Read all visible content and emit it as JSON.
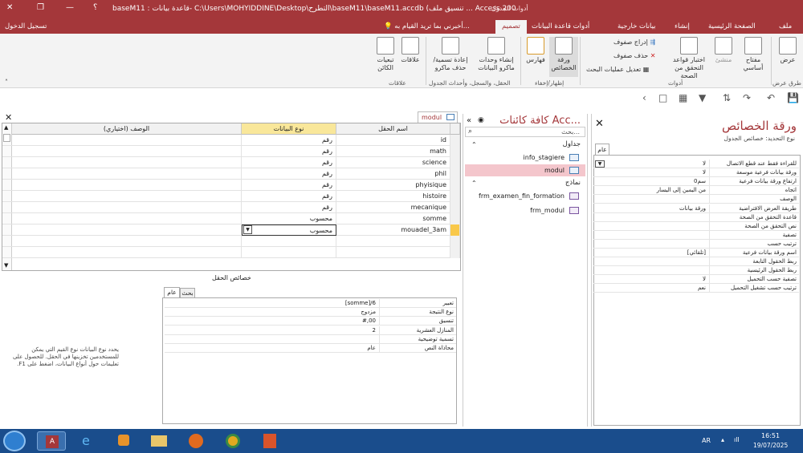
{
  "window": {
    "title": "baseM11 : قاعدة بيانات- C:\\Users\\MOHYIDDINE\\Desktop\\التطرح\\baseM11\\baseM11.accdb (تنسيق ملف ... Access 200",
    "context_tab": "أدوات الجدول",
    "help": "؟",
    "minimize": "—",
    "restore": "❐",
    "close": "✕"
  },
  "tabs": {
    "file": "ملف",
    "home": "الصفحة الرئيسية",
    "create": "إنشاء",
    "external": "بيانات خارجية",
    "dbtools": "أدوات قاعدة البيانات",
    "design": "تصميم",
    "tellme": "أخبرني بما تريد القيام به...",
    "signin": "تسجيل الدخول"
  },
  "ribbon": {
    "view": "عرض",
    "primary_key": "مفتاح أساسي",
    "builder": "منشئ",
    "test_rules": "اختبار قواعد التحقق من الصحة",
    "insert_rows": "إدراج صفوف",
    "delete_rows": "حذف صفوف",
    "modify_lookups": "تعديل عمليات البحث",
    "property_sheet": "ورقة الخصائص",
    "indexes": "فهارس",
    "data_macros": "إنشاء وحدات ماكرو البيانات",
    "rename_macro": "إعادة تسمية/ حذف ماكرو",
    "relationships": "علاقات",
    "dependencies": "تبعيات الكائن",
    "group_views": "طرق عرض",
    "group_tools": "أدوات",
    "group_showhide": "إظهار/إخفاء",
    "group_events": "الحقل، والسجل، وأحداث الجدول",
    "group_relations": "علاقات"
  },
  "property_sheet": {
    "title": "ورقة الخصائص",
    "selection": "نوع التحديد:  خصائص الجدول",
    "tab": "عام",
    "close": "✕",
    "rows": [
      {
        "label": "للقراءة فقط عند قطع الاتصال",
        "value": "لا"
      },
      {
        "label": "ورقة بيانات فرعية موسعة",
        "value": "لا"
      },
      {
        "label": "ارتفاع ورقة بيانات فرعية",
        "value": "0سم"
      },
      {
        "label": "اتجاه",
        "value": "من اليمين إلى اليسار"
      },
      {
        "label": "الوصف",
        "value": ""
      },
      {
        "label": "طريقة العرض الافتراضية",
        "value": "ورقة بيانات"
      },
      {
        "label": "قاعدة التحقق من الصحة",
        "value": ""
      },
      {
        "label": "نص التحقق من الصحة",
        "value": ""
      },
      {
        "label": "تصفية",
        "value": ""
      },
      {
        "label": "ترتيب حسب",
        "value": ""
      },
      {
        "label": "اسم ورقة بيانات فرعية",
        "value": "[تلقائي]"
      },
      {
        "label": "ربط الحقول التابعة",
        "value": ""
      },
      {
        "label": "ربط الحقول الرئيسية",
        "value": ""
      },
      {
        "label": "تصفية حسب التحميل",
        "value": "لا"
      },
      {
        "label": "ترتيب حسب تشغيل التحميل",
        "value": "نعم"
      }
    ]
  },
  "navigation": {
    "title": "كافة كائنات Acc...",
    "search_placeholder": "بحث...",
    "tables_header": "جداول",
    "forms_header": "نماذج",
    "tables": [
      "info_stagiere",
      "modul"
    ],
    "forms": [
      "frm_examen_fin_formation",
      "frm_modul"
    ]
  },
  "design_tab": "modul",
  "grid": {
    "col_name": "اسم الحقل",
    "col_type": "نوع البيانات",
    "col_desc": "الوصف (اختياري)",
    "rows": [
      {
        "name": "id",
        "type": "رقم"
      },
      {
        "name": "math",
        "type": "رقم"
      },
      {
        "name": "science",
        "type": "رقم"
      },
      {
        "name": "phil",
        "type": "رقم"
      },
      {
        "name": "phyisique",
        "type": "رقم"
      },
      {
        "name": "histoire",
        "type": "رقم"
      },
      {
        "name": "mecanique",
        "type": "رقم"
      },
      {
        "name": "somme",
        "type": "محسوب"
      },
      {
        "name": "mouadel_3am",
        "type": "محسوب"
      }
    ]
  },
  "field_properties": {
    "title": "خصائص الحقل",
    "tab_general": "عام",
    "tab_lookup": "بحث",
    "rows": [
      {
        "label": "تعبير",
        "value": "[somme]/6"
      },
      {
        "label": "نوع النتيجة",
        "value": "مزدوج"
      },
      {
        "label": "تنسيق",
        "value": "#,00"
      },
      {
        "label": "المنازل العشرية",
        "value": "2"
      },
      {
        "label": "تسمية توضيحية",
        "value": ""
      },
      {
        "label": "محاذاة النص",
        "value": "عام"
      }
    ],
    "help": "يحدد نوع البيانات نوع القيم التي يمكن للمستخدمين تخزينها في الحقل. للحصول على تعليمات حول أنواع البيانات، اضغط على F1."
  },
  "taskbar": {
    "lang": "AR",
    "time": "16:51",
    "date": "19/07/2025"
  },
  "colors": {
    "accent": "#a4373a",
    "taskbar": "#1a4d8c"
  }
}
